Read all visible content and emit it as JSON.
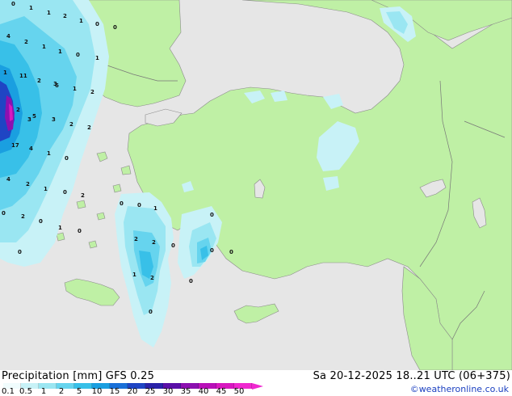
{
  "header": {
    "title_left": "Precipitation [mm]  GFS 0.25",
    "title_right": "Sa 20-12-2025 18..21 UTC (06+375)",
    "credit": "©weatheronline.co.uk"
  },
  "legend": {
    "ticks": [
      "0.1",
      "0.5",
      "1",
      "2",
      "5",
      "10",
      "15",
      "20",
      "25",
      "30",
      "35",
      "40",
      "45",
      "50"
    ],
    "colors": [
      "#f0fcfd",
      "#c8f2f7",
      "#9ae6f2",
      "#66d4ee",
      "#38c0e8",
      "#1a9fe0",
      "#1a70d8",
      "#1f45c4",
      "#2a22a8",
      "#5a0fa8",
      "#8c10b0",
      "#b810b8",
      "#d818c0",
      "#f028d0"
    ]
  },
  "map": {
    "sea_color": "#e6e6e6",
    "land_color": "#bff0a5",
    "labels": [
      "0",
      "1",
      "1",
      "2",
      "1",
      "0",
      "0",
      "4",
      "2",
      "1",
      "1",
      "0",
      "1",
      "1",
      "11",
      "2",
      "3",
      "3",
      "1",
      "2",
      "2",
      "6",
      "2",
      "5",
      "3",
      "2",
      "17",
      "4",
      "1",
      "0",
      "4",
      "2",
      "1",
      "0",
      "2",
      "0",
      "2",
      "0",
      "1",
      "0",
      "0",
      "0",
      "0",
      "1",
      "0",
      "2",
      "2",
      "0",
      "0",
      "0",
      "1",
      "2",
      "0",
      "0"
    ]
  }
}
